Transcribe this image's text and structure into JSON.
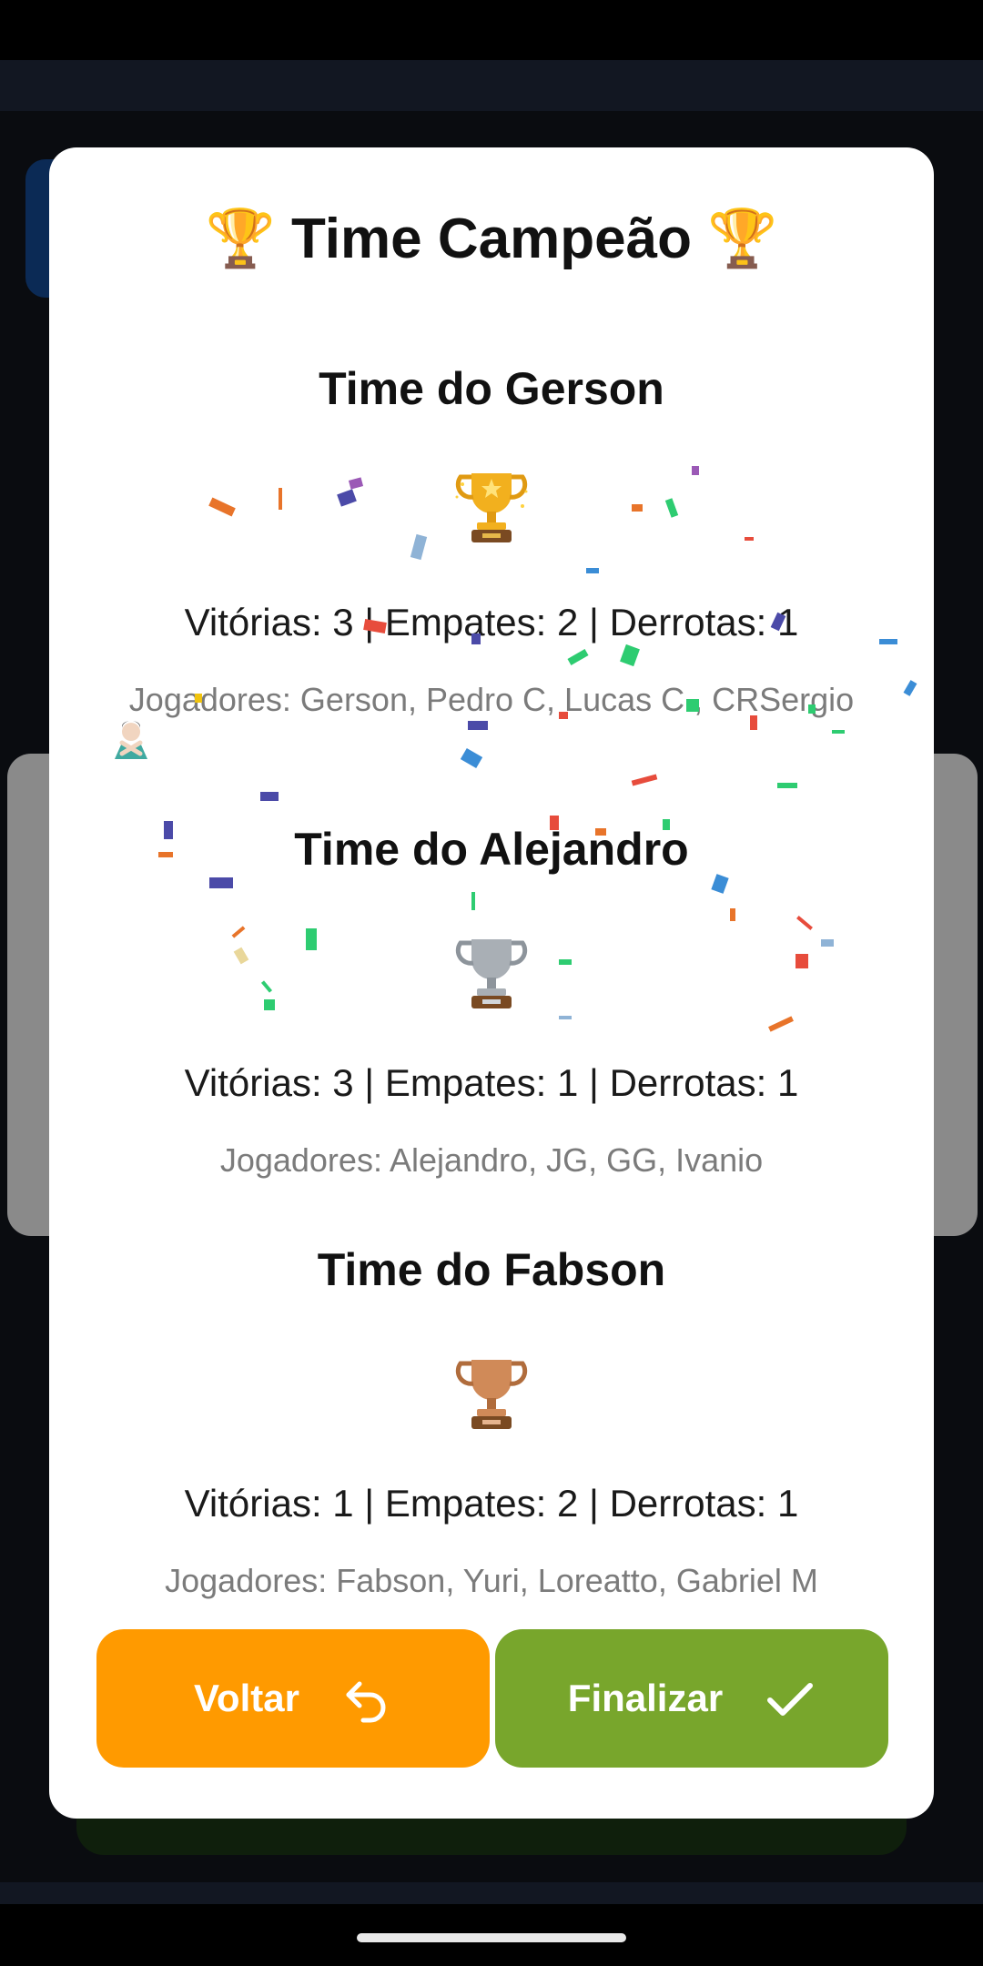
{
  "dialog": {
    "title": "🏆 Time Campeão 🏆"
  },
  "teams": [
    {
      "name": "Time do Gerson",
      "medal_icon": "gold-trophy-icon",
      "stats": "Vitórias: 3 | Empates: 2 | Derrotas: 1",
      "players": "Jogadores: Gerson, Pedro C, Lucas C., CRSergio"
    },
    {
      "name": "Time do Alejandro",
      "medal_icon": "silver-trophy-icon",
      "stats": "Vitórias: 3 | Empates: 1 | Derrotas: 1",
      "players": "Jogadores: Alejandro, JG, GG, Ivanio"
    },
    {
      "name": "Time do Fabson",
      "medal_icon": "bronze-trophy-icon",
      "stats": "Vitórias: 1 | Empates: 2 | Derrotas: 1",
      "players": "Jogadores: Fabson, Yuri, Loreatto, Gabriel M"
    }
  ],
  "buttons": {
    "back_label": "Voltar",
    "finish_label": "Finalizar"
  },
  "colors": {
    "back_button": "#ff9a00",
    "finish_button": "#78a62c",
    "gold": "#f2b01e",
    "silver": "#9aa0a6",
    "bronze": "#c97a45"
  }
}
